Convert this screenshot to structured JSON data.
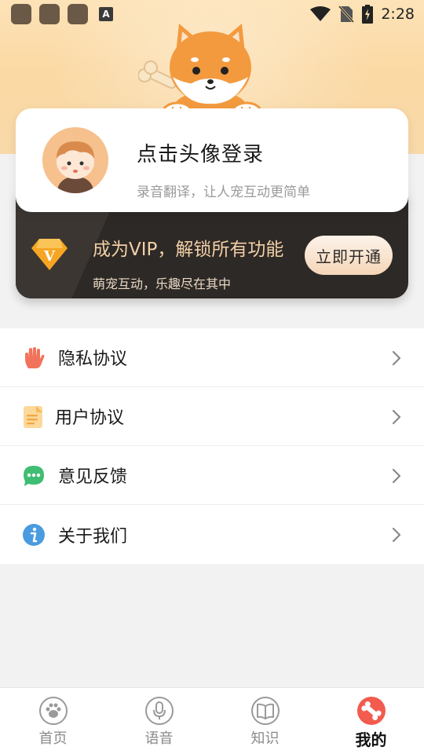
{
  "status_bar": {
    "time": "2:28",
    "notification_a": "A"
  },
  "profile": {
    "login_title": "点击头像登录",
    "subtitle": "录音翻译，让人宠互动更简单"
  },
  "vip": {
    "badge_letter": "V",
    "title": "成为VIP，解锁所有功能",
    "subtitle": "萌宠互动，乐趣尽在其中",
    "button_label": "立即开通"
  },
  "menu": {
    "items": [
      {
        "label": "隐私协议",
        "icon": "hand-icon"
      },
      {
        "label": "用户协议",
        "icon": "document-icon"
      },
      {
        "label": "意见反馈",
        "icon": "chat-bubble-icon"
      },
      {
        "label": "关于我们",
        "icon": "info-icon"
      }
    ]
  },
  "bottom_nav": {
    "tabs": [
      {
        "label": "首页",
        "icon": "paw-icon",
        "active": false
      },
      {
        "label": "语音",
        "icon": "microphone-icon",
        "active": false
      },
      {
        "label": "知识",
        "icon": "book-icon",
        "active": false
      },
      {
        "label": "我的",
        "icon": "bone-icon",
        "active": true
      }
    ]
  },
  "colors": {
    "header_bg": "#fbd9a4",
    "vip_bg": "#2d2926",
    "vip_text": "#f2cfa6",
    "active_tab_icon": "#f25b4e"
  }
}
